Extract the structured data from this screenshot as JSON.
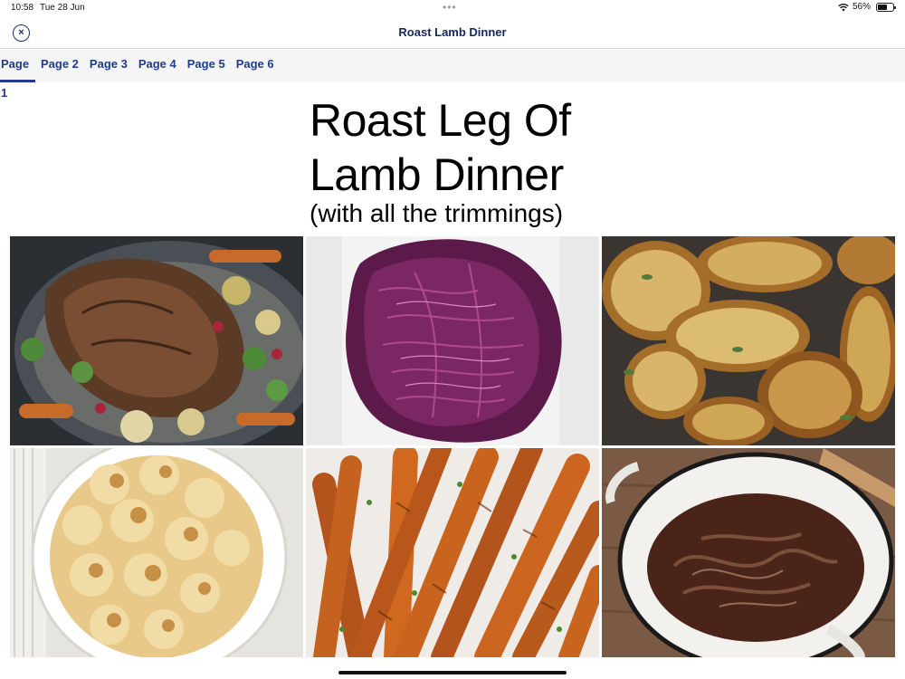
{
  "status_bar": {
    "time": "10:58",
    "date": "Tue 28 Jun",
    "more_dots": "•••",
    "battery_percent": "56%",
    "battery_level": 0.56
  },
  "nav": {
    "close_icon": "×",
    "title": "Roast Lamb Dinner"
  },
  "tabs": [
    {
      "label": "Page 1",
      "active": true
    },
    {
      "label": "Page 2",
      "active": false
    },
    {
      "label": "Page 3",
      "active": false
    },
    {
      "label": "Page 4",
      "active": false
    },
    {
      "label": "Page 5",
      "active": false
    },
    {
      "label": "Page 6",
      "active": false
    }
  ],
  "document": {
    "title_line1": "Roast Leg Of",
    "title_line2": "Lamb Dinner",
    "subtitle": "(with all the trimmings)"
  },
  "photos": [
    {
      "name": "roast-lamb-photo"
    },
    {
      "name": "red-cabbage-photo"
    },
    {
      "name": "roast-potatoes-photo"
    },
    {
      "name": "cauliflower-cheese-photo"
    },
    {
      "name": "roasted-carrots-photo"
    },
    {
      "name": "gravy-pot-photo"
    }
  ],
  "colors": {
    "accent": "#1e3d8c",
    "nav_title": "#14275e",
    "tab_bar_bg": "#f5f5f6"
  }
}
